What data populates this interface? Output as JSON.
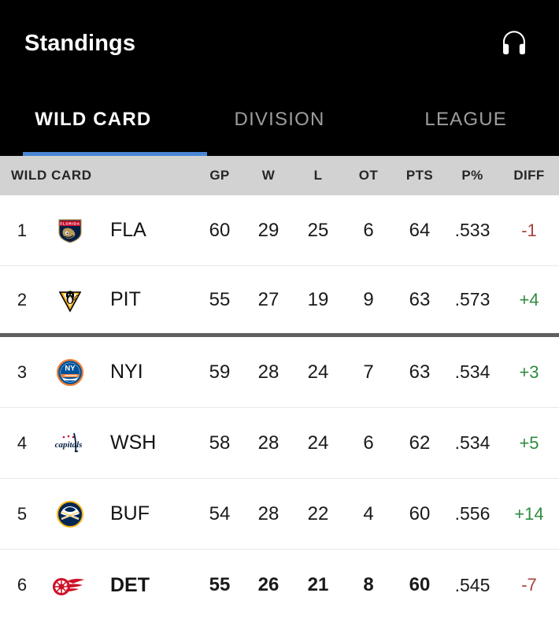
{
  "header": {
    "title": "Standings",
    "audio_icon": "headphones-icon"
  },
  "tabs": [
    {
      "label": "WILD CARD",
      "active": true
    },
    {
      "label": "DIVISION",
      "active": false
    },
    {
      "label": "LEAGUE",
      "active": false
    }
  ],
  "theme": {
    "appbar_bg": "#000000",
    "tab_indicator": "#4a86d4",
    "header_row_bg": "#d2d2d2",
    "pts_highlight": "#ececec",
    "cutoff_line": "#5f5f5f",
    "diff_positive": "#2e8b40",
    "diff_negative": "#a8413c"
  },
  "columns": {
    "group": "WILD CARD",
    "gp": "GP",
    "w": "W",
    "l": "L",
    "ot": "OT",
    "pts": "PTS",
    "ppct": "P%",
    "diff": "DIFF"
  },
  "rows": [
    {
      "rank": "1",
      "team": "FLA",
      "logo": "florida-panthers-logo",
      "gp": "60",
      "w": "29",
      "l": "25",
      "ot": "6",
      "pts": "64",
      "ppct": ".533",
      "diff": "-1",
      "diff_sign": "neg",
      "highlighted": false,
      "cutoff_after": false
    },
    {
      "rank": "2",
      "team": "PIT",
      "logo": "pittsburgh-penguins-logo",
      "gp": "55",
      "w": "27",
      "l": "19",
      "ot": "9",
      "pts": "63",
      "ppct": ".573",
      "diff": "+4",
      "diff_sign": "pos",
      "highlighted": false,
      "cutoff_after": true
    },
    {
      "rank": "3",
      "team": "NYI",
      "logo": "new-york-islanders-logo",
      "gp": "59",
      "w": "28",
      "l": "24",
      "ot": "7",
      "pts": "63",
      "ppct": ".534",
      "diff": "+3",
      "diff_sign": "pos",
      "highlighted": false,
      "cutoff_after": false
    },
    {
      "rank": "4",
      "team": "WSH",
      "logo": "washington-capitals-logo",
      "gp": "58",
      "w": "28",
      "l": "24",
      "ot": "6",
      "pts": "62",
      "ppct": ".534",
      "diff": "+5",
      "diff_sign": "pos",
      "highlighted": false,
      "cutoff_after": false
    },
    {
      "rank": "5",
      "team": "BUF",
      "logo": "buffalo-sabres-logo",
      "gp": "54",
      "w": "28",
      "l": "22",
      "ot": "4",
      "pts": "60",
      "ppct": ".556",
      "diff": "+14",
      "diff_sign": "pos",
      "highlighted": false,
      "cutoff_after": false
    },
    {
      "rank": "6",
      "team": "DET",
      "logo": "detroit-red-wings-logo",
      "gp": "55",
      "w": "26",
      "l": "21",
      "ot": "8",
      "pts": "60",
      "ppct": ".545",
      "diff": "-7",
      "diff_sign": "neg",
      "highlighted": true,
      "cutoff_after": false
    }
  ]
}
